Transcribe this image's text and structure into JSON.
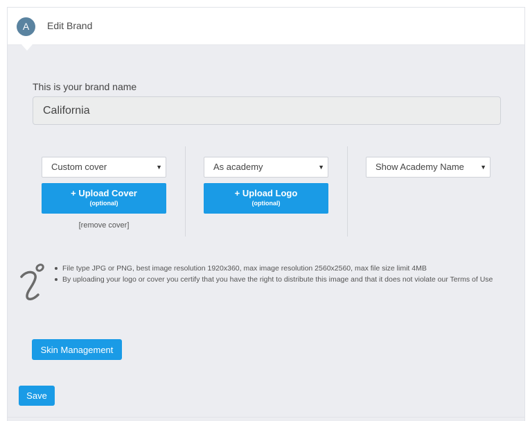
{
  "header": {
    "avatar_letter": "A",
    "title": "Edit Brand"
  },
  "brand": {
    "label": "This is your brand name",
    "value": "California"
  },
  "cover": {
    "selected": "Custom cover",
    "upload_label": "+ Upload Cover",
    "upload_sub": "(optional)",
    "remove_label": "[remove cover]"
  },
  "logo": {
    "selected": "As academy",
    "upload_label": "+ Upload Logo",
    "upload_sub": "(optional)"
  },
  "name_display": {
    "selected": "Show Academy Name"
  },
  "info": {
    "items": [
      "File type JPG or PNG, best image resolution 1920x360, max image resolution 2560x2560, max file size limit 4MB",
      "By uploading your logo or cover you certify that you have the right to distribute this image and that it does not violate our Terms of Use"
    ]
  },
  "buttons": {
    "skin_management": "Skin Management",
    "save": "Save"
  },
  "colors": {
    "accent": "#1a9be6",
    "avatar": "#5a83a0",
    "background": "#ecedf1"
  }
}
